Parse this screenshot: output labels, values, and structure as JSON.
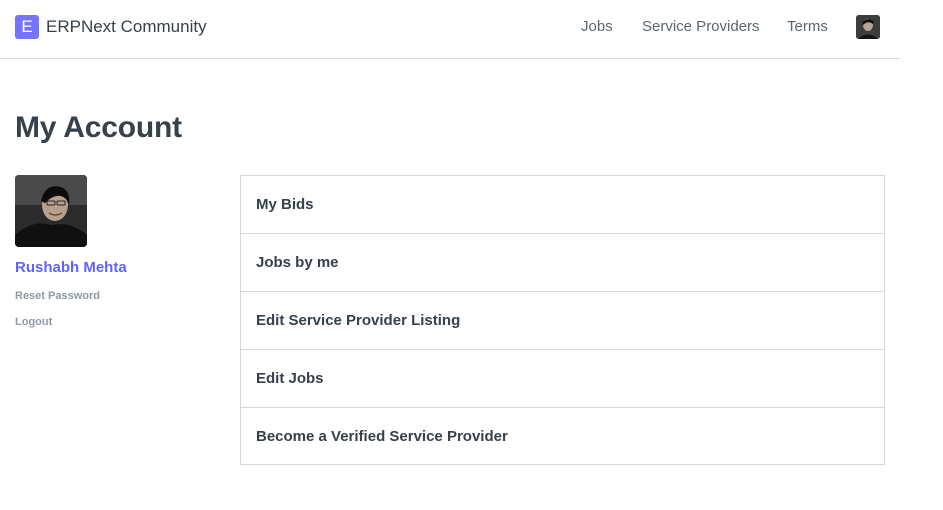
{
  "navbar": {
    "brand_letter": "E",
    "brand_name": "ERPNext Community",
    "links": [
      "Jobs",
      "Service Providers",
      "Terms"
    ],
    "accent_color": "#7574ff"
  },
  "page": {
    "title": "My Account"
  },
  "profile": {
    "name": "Rushabh Mehta",
    "name_color": "#5e64ff",
    "reset_password": "Reset Password",
    "logout": "Logout"
  },
  "menu": {
    "items": [
      "My Bids",
      "Jobs by me",
      "Edit Service Provider Listing",
      "Edit Jobs",
      "Become a Verified Service Provider"
    ]
  }
}
